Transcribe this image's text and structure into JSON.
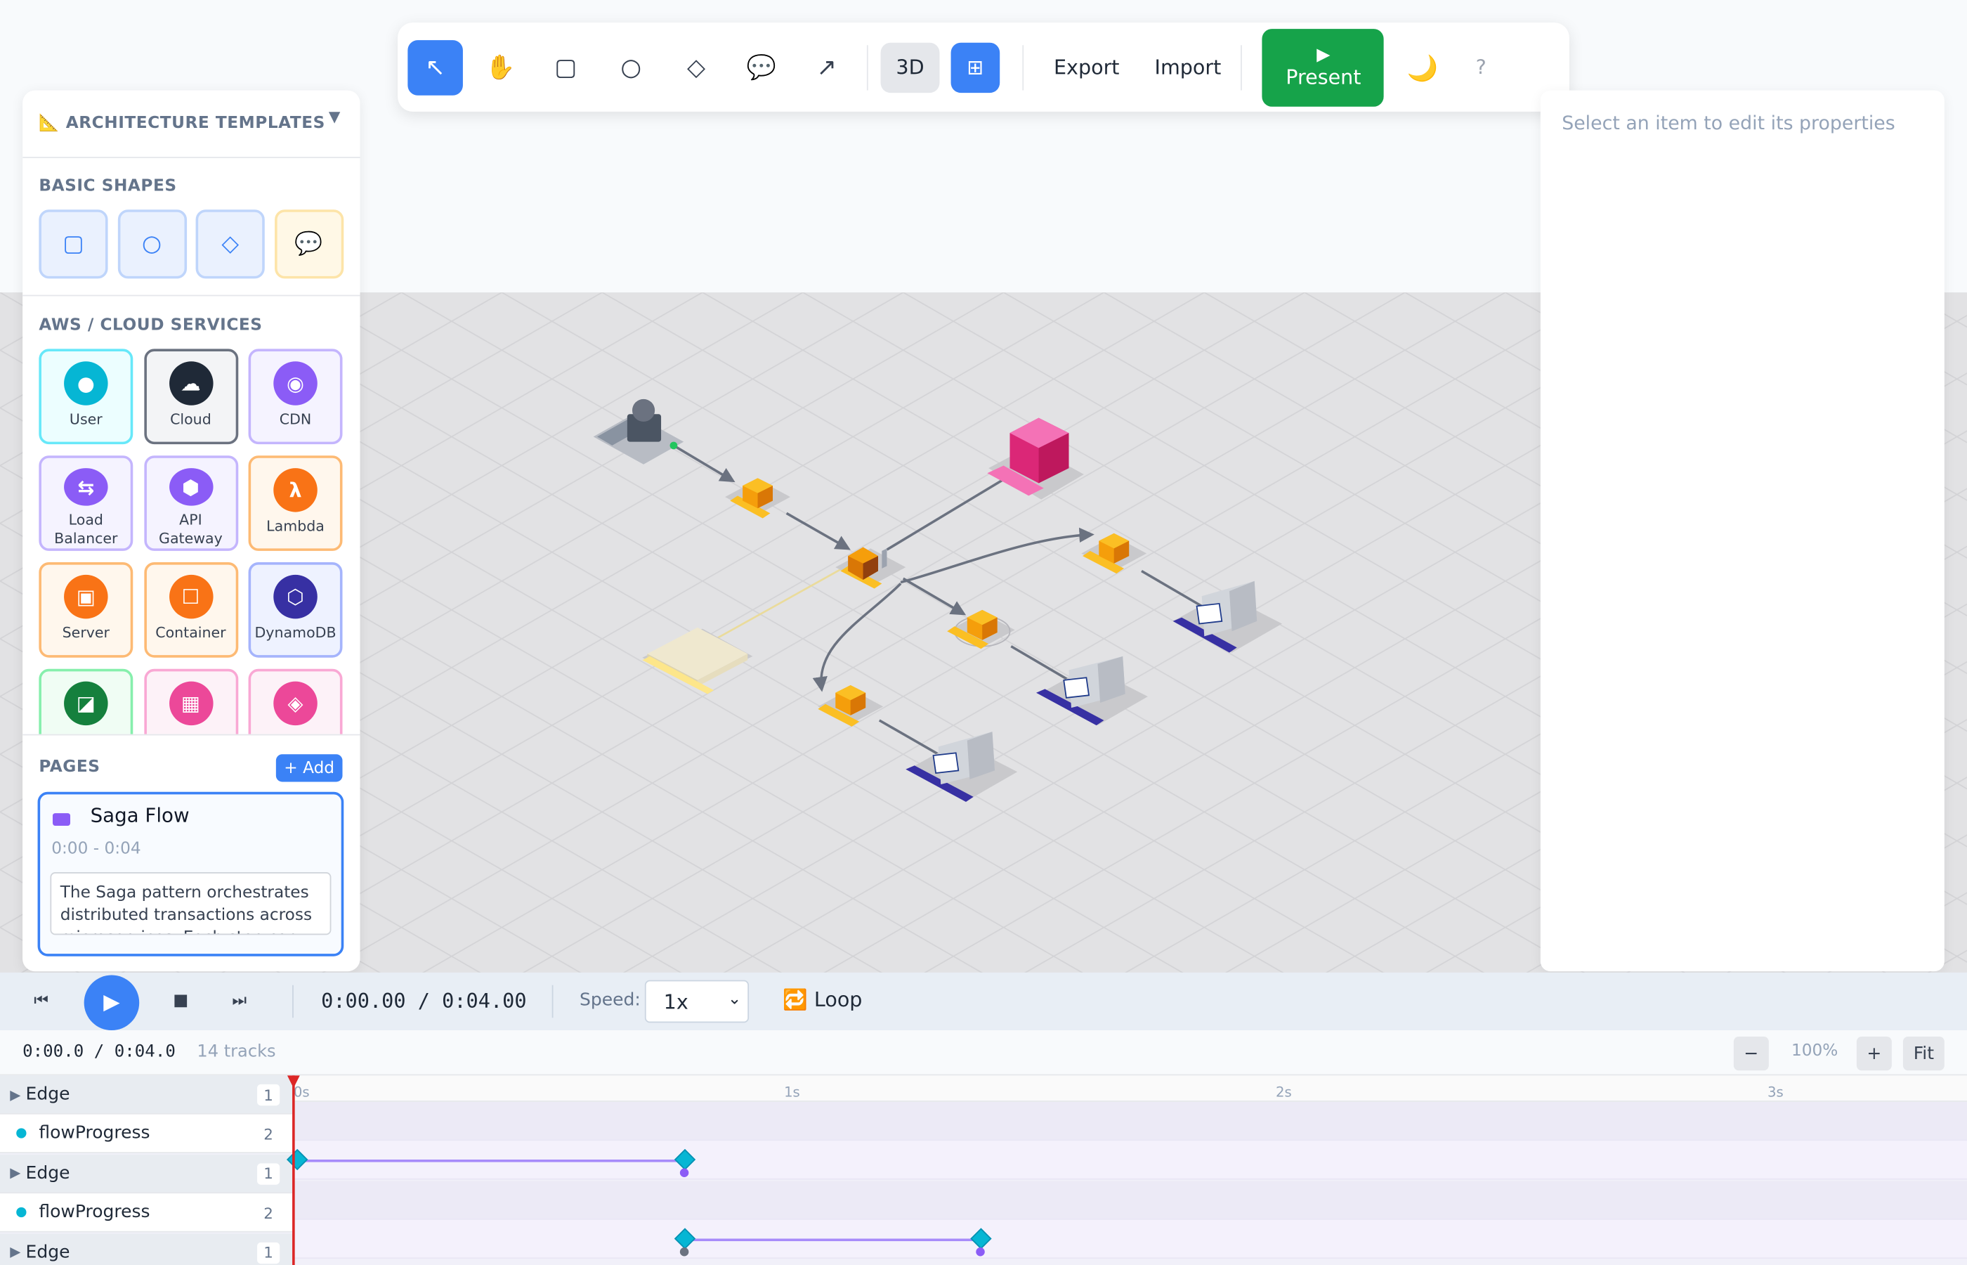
{
  "toolbar": {
    "tools": [
      {
        "name": "select-tool",
        "icon": "↖"
      },
      {
        "name": "pan-tool",
        "icon": "✋"
      },
      {
        "name": "rectangle-tool",
        "icon": "▢"
      },
      {
        "name": "circle-tool",
        "icon": "○"
      },
      {
        "name": "diamond-tool",
        "icon": "◇"
      },
      {
        "name": "comment-tool",
        "icon": "💬"
      },
      {
        "name": "arrow-tool",
        "icon": "↗"
      }
    ],
    "view3d_label": "3D",
    "grid_icon": "⊞",
    "export_label": "Export",
    "import_label": "Import",
    "present_icon": "▶",
    "present_label": "Present",
    "theme_icon": "🌙",
    "help_label": "?"
  },
  "sidebar": {
    "templates_icon": "📐",
    "templates_title": "ARCHITECTURE TEMPLATES",
    "templates_chevron": "▼",
    "basic_shapes_title": "BASIC SHAPES",
    "basic_shapes": [
      {
        "icon": "▢",
        "bg": "#eaf1fe",
        "border": "#bfd5fb",
        "color": "#3b82f6"
      },
      {
        "icon": "○",
        "bg": "#eaf1fe",
        "border": "#bfd5fb",
        "color": "#3b82f6"
      },
      {
        "icon": "◇",
        "bg": "#eaf1fe",
        "border": "#bfd5fb",
        "color": "#3b82f6"
      },
      {
        "icon": "💬",
        "bg": "#fff8e6",
        "border": "#fde4a8",
        "color": "#374151"
      }
    ],
    "cloud_title": "AWS / CLOUD SERVICES",
    "services": [
      {
        "label": "User",
        "icon": "●",
        "color": "#06b6d4",
        "bg": "#ecfeff",
        "border": "#67e8f9"
      },
      {
        "label": "Cloud",
        "icon": "☁",
        "color": "#1f2937",
        "bg": "#f3f4f6",
        "border": "#6b7280"
      },
      {
        "label": "CDN",
        "icon": "◉",
        "color": "#8b5cf6",
        "bg": "#f5f3ff",
        "border": "#c4b5fd"
      },
      {
        "label": "Load Balancer",
        "icon": "⇆",
        "color": "#8b5cf6",
        "bg": "#f5f3ff",
        "border": "#c4b5fd"
      },
      {
        "label": "API Gateway",
        "icon": "⬢",
        "color": "#8b5cf6",
        "bg": "#f5f3ff",
        "border": "#c4b5fd"
      },
      {
        "label": "Lambda",
        "icon": "λ",
        "color": "#f97316",
        "bg": "#fff7ed",
        "border": "#fdba74"
      },
      {
        "label": "Server",
        "icon": "▣",
        "color": "#f97316",
        "bg": "#fff7ed",
        "border": "#fdba74"
      },
      {
        "label": "Container",
        "icon": "☐",
        "color": "#f97316",
        "bg": "#fff7ed",
        "border": "#fdba74"
      },
      {
        "label": "DynamoDB",
        "icon": "⬡",
        "color": "#3730a3",
        "bg": "#eef2ff",
        "border": "#a5b4fc"
      },
      {
        "label": "",
        "icon": "◪",
        "color": "#15803d",
        "bg": "#f0fdf4",
        "border": "#86efac"
      },
      {
        "label": "",
        "icon": "▦",
        "color": "#ec4899",
        "bg": "#fdf2f8",
        "border": "#f9a8d4"
      },
      {
        "label": "",
        "icon": "◈",
        "color": "#ec4899",
        "bg": "#fdf2f8",
        "border": "#f9a8d4"
      }
    ],
    "pages_title": "PAGES",
    "add_label": "+ Add",
    "page": {
      "name": "Saga Flow",
      "color": "#8b5cf6",
      "time": "0:00 - 0:04",
      "description": "The Saga pattern orchestrates distributed transactions across microservices. Each step can be"
    }
  },
  "properties": {
    "placeholder": "Select an item to edit its properties"
  },
  "playback": {
    "skip_back_icon": "⏮",
    "play_icon": "▶",
    "stop_icon": "■",
    "skip_fwd_icon": "⏭",
    "timecode": "0:00.00 / 0:04.00",
    "speed_label": "Speed:",
    "speed_value": "1x",
    "speed_arrow": "⌄",
    "loop_label": "🔁 Loop"
  },
  "timeline": {
    "timecode": "0:00.0 / 0:04.0",
    "tracks_count": "14 tracks",
    "zoom_out": "−",
    "zoom_level": "100%",
    "zoom_in": "+",
    "fit_label": "Fit",
    "ticks": [
      "0s",
      "1s",
      "2s",
      "3s"
    ],
    "rows": [
      {
        "type": "group",
        "label": "Edge",
        "count": "1"
      },
      {
        "type": "prop",
        "label": "flowProgress",
        "count": "2"
      },
      {
        "type": "group",
        "label": "Edge",
        "count": "1"
      },
      {
        "type": "prop",
        "label": "flowProgress",
        "count": "2"
      },
      {
        "type": "group",
        "label": "Edge",
        "count": "1"
      }
    ]
  }
}
